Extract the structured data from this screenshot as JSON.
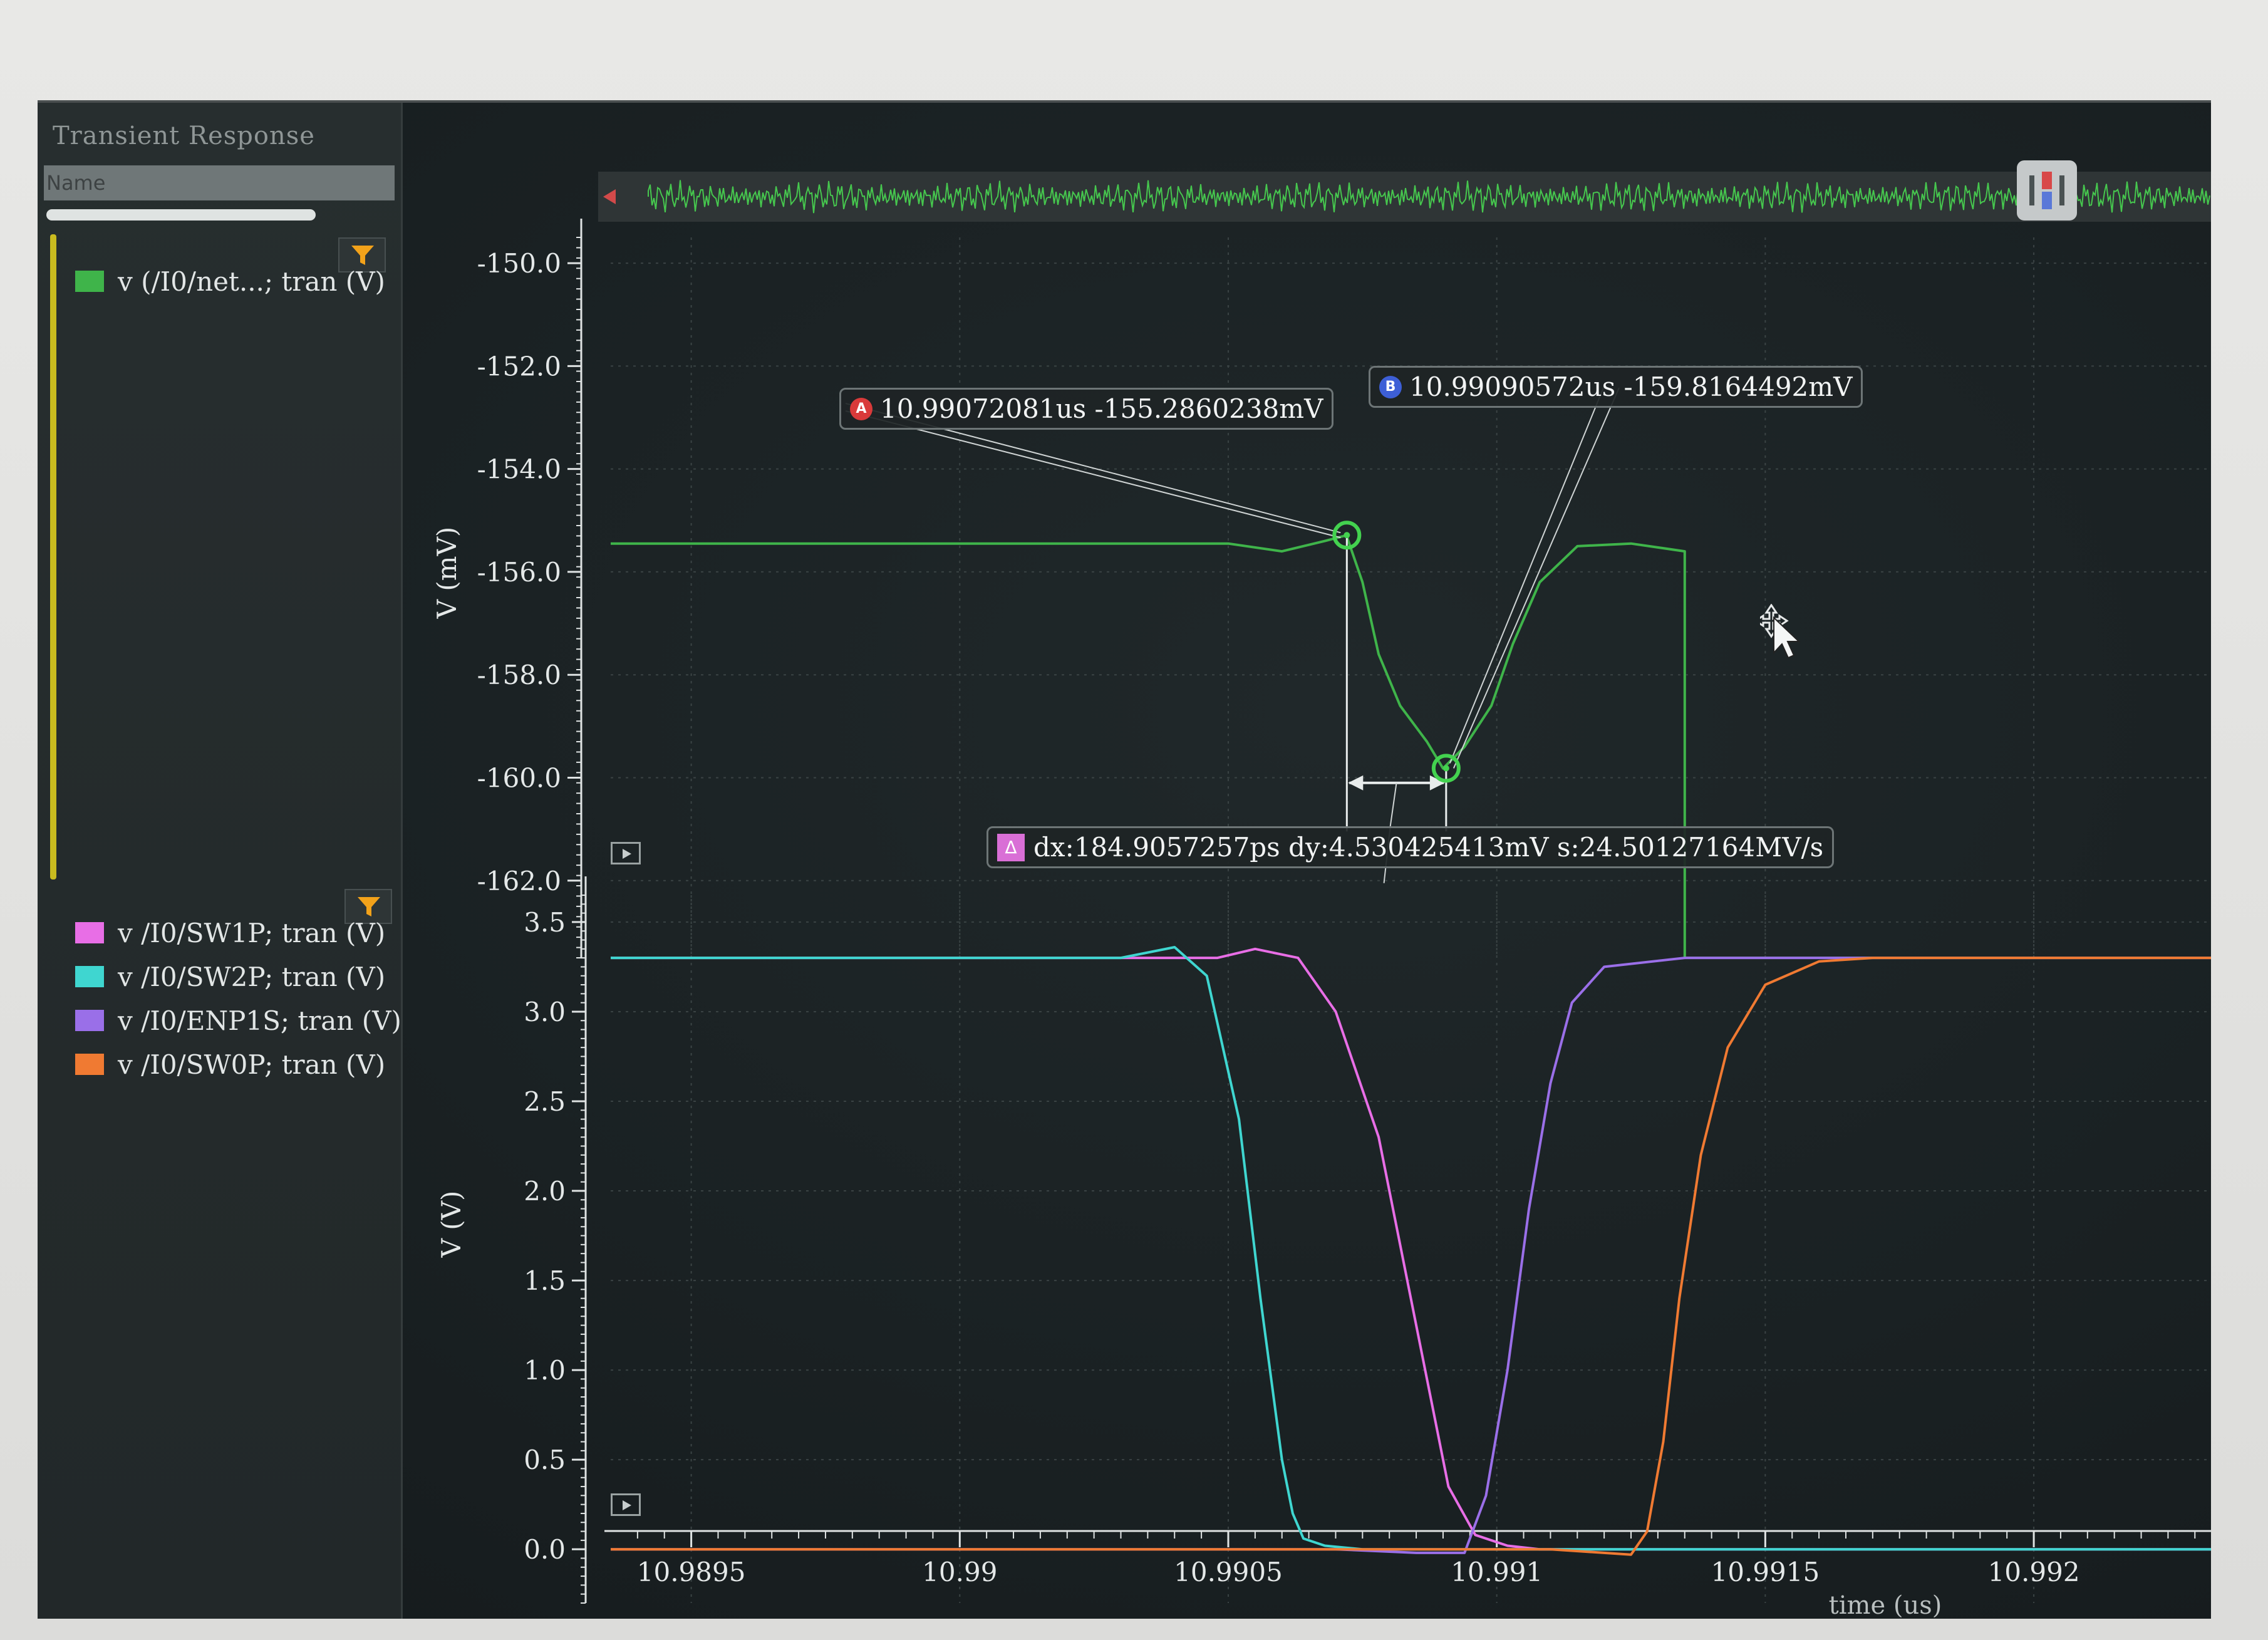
{
  "window": {
    "title": "Transient Response"
  },
  "browser": {
    "name_header": "Name"
  },
  "legend_top": [
    {
      "label": "v (/I0/net...; tran (V)",
      "color": "#3fb44a"
    }
  ],
  "legend_bottom": [
    {
      "label": "v /I0/SW1P; tran (V)",
      "color": "#e86ee6"
    },
    {
      "label": "v /I0/SW2P; tran (V)",
      "color": "#3fd6d0"
    },
    {
      "label": "v /I0/ENP1S; tran (V)",
      "color": "#9a6fe8"
    },
    {
      "label": "v /I0/SW0P; tran (V)",
      "color": "#f07a32"
    }
  ],
  "markers": {
    "a": {
      "badge": "A",
      "text": "10.99072081us -155.2860238mV",
      "x": 10.99072081,
      "y": -155.2860238
    },
    "b": {
      "badge": "B",
      "text": "10.99090572us -159.8164492mV",
      "x": 10.99090572,
      "y": -159.8164492
    },
    "delta": {
      "badge": "Δ",
      "text": "dx:184.9057257ps dy:4.530425413mV s:24.50127164MV/s"
    }
  },
  "icons": {
    "filter": "filter-icon",
    "play": "play-icon",
    "cursor": "move-cursor-icon",
    "overview_toggle": "overview-toggle-icon"
  },
  "chart_data": [
    {
      "type": "line",
      "ylabel": "V (mV)",
      "ylim": [
        -163.5,
        -149.5
      ],
      "yticks": [
        -150.0,
        -152.0,
        -154.0,
        -156.0,
        -158.0,
        -160.0,
        -162.0
      ],
      "xlim": [
        10.98935,
        10.99233
      ],
      "grid": true,
      "series": [
        {
          "name": "v (/I0/net...; tran (V)",
          "color": "#3fb44a",
          "x": [
            10.98935,
            10.99,
            10.9905,
            10.9906,
            10.99068,
            10.99072,
            10.99075,
            10.99078,
            10.99082,
            10.99087,
            10.9909,
            10.99094,
            10.99099,
            10.99103,
            10.99108,
            10.99115,
            10.99125,
            10.99135,
            10.99135,
            10.993,
            10.99312,
            10.99312
          ],
          "y": [
            -155.45,
            -155.45,
            -155.45,
            -155.6,
            -155.4,
            -155.29,
            -156.2,
            -157.6,
            -158.6,
            -159.3,
            -159.82,
            -159.4,
            -158.6,
            -157.4,
            -156.2,
            -155.5,
            -155.45,
            -155.6,
            -163.5,
            -163.5,
            -163.5,
            -149.5
          ]
        }
      ]
    },
    {
      "type": "line",
      "ylabel": "V (V)",
      "xlabel": "time (us)",
      "ylim": [
        -0.3,
        3.65
      ],
      "yticks": [
        0.0,
        0.5,
        1.0,
        1.5,
        2.0,
        2.5,
        3.0,
        3.5
      ],
      "xlim": [
        10.98935,
        10.99233
      ],
      "xticks": [
        10.9895,
        10.99,
        10.9905,
        10.991,
        10.9915,
        10.992
      ],
      "xtick_labels": [
        "10.9895",
        "10.99",
        "10.9905",
        "10.991",
        "10.9915",
        "10.992"
      ],
      "grid": true,
      "series": [
        {
          "name": "v /I0/SW1P; tran (V)",
          "color": "#e86ee6",
          "x": [
            10.98935,
            10.9902,
            10.99048,
            10.99055,
            10.99063,
            10.9907,
            10.99078,
            10.99084,
            10.99088,
            10.99091,
            10.99096,
            10.99102,
            10.99108,
            10.9912,
            10.99233
          ],
          "y": [
            3.3,
            3.3,
            3.3,
            3.35,
            3.3,
            3.0,
            2.3,
            1.4,
            0.8,
            0.35,
            0.08,
            0.02,
            0.0,
            0.0,
            0.0
          ]
        },
        {
          "name": "v /I0/SW2P; tran (V)",
          "color": "#3fd6d0",
          "x": [
            10.98935,
            10.9903,
            10.9904,
            10.99046,
            10.99052,
            10.99056,
            10.9906,
            10.99062,
            10.99064,
            10.99068,
            10.99075,
            10.99233
          ],
          "y": [
            3.3,
            3.3,
            3.36,
            3.2,
            2.4,
            1.4,
            0.5,
            0.2,
            0.06,
            0.02,
            0.0,
            0.0
          ]
        },
        {
          "name": "v /I0/ENP1S; tran (V)",
          "color": "#9a6fe8",
          "x": [
            10.98935,
            10.9907,
            10.99085,
            10.99094,
            10.99098,
            10.99102,
            10.99106,
            10.9911,
            10.99114,
            10.9912,
            10.99135,
            10.99155,
            10.99233
          ],
          "y": [
            0.0,
            0.0,
            -0.02,
            -0.02,
            0.3,
            1.0,
            1.9,
            2.6,
            3.05,
            3.25,
            3.3,
            3.3,
            3.3
          ]
        },
        {
          "name": "v /I0/SW0P; tran (V)",
          "color": "#f07a32",
          "x": [
            10.98935,
            10.9911,
            10.99125,
            10.99128,
            10.99131,
            10.99134,
            10.99138,
            10.99143,
            10.9915,
            10.9916,
            10.9917,
            10.99233
          ],
          "y": [
            0.0,
            0.0,
            -0.03,
            0.1,
            0.6,
            1.4,
            2.2,
            2.8,
            3.15,
            3.28,
            3.3,
            3.3
          ]
        }
      ]
    }
  ]
}
